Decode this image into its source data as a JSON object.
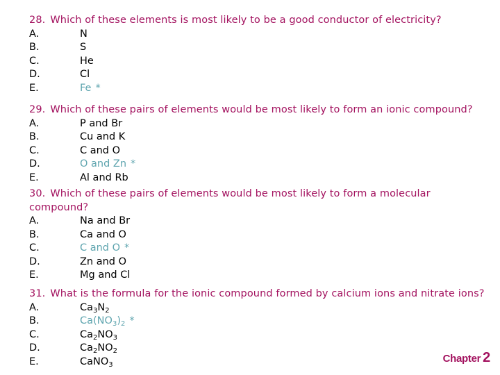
{
  "colors": {
    "question": "#A3125F",
    "answer_correct": "#5FA5AF",
    "option_text": "#000000"
  },
  "questions": [
    {
      "number": "28.",
      "text": "Which of these elements is most likely to be a good conductor of electricity?",
      "options": [
        {
          "letter": "A.",
          "value": "N",
          "correct": false
        },
        {
          "letter": "B.",
          "value": "S",
          "correct": false
        },
        {
          "letter": "C.",
          "value": "He",
          "correct": false
        },
        {
          "letter": "D.",
          "value": "Cl",
          "correct": false
        },
        {
          "letter": "E.",
          "value": "Fe",
          "correct": true,
          "marker": "*"
        }
      ]
    },
    {
      "number": "29.",
      "text": "Which of these pairs of elements would be most likely to form an ionic compound?",
      "options": [
        {
          "letter": "A.",
          "value": "P and Br",
          "correct": false
        },
        {
          "letter": "B.",
          "value": "Cu and K",
          "correct": false
        },
        {
          "letter": "C.",
          "value": "C and O",
          "correct": false
        },
        {
          "letter": "D.",
          "value": "O and Zn",
          "correct": true,
          "marker": "*"
        },
        {
          "letter": "E.",
          "value": "Al and Rb",
          "correct": false
        }
      ]
    },
    {
      "number": "30.",
      "text": "Which of these pairs of elements would be most likely to form a molecular compound?",
      "options": [
        {
          "letter": "A.",
          "value": "Na and Br",
          "correct": false
        },
        {
          "letter": "B.",
          "value": "Ca and O",
          "correct": false
        },
        {
          "letter": "C.",
          "value": "C and O",
          "correct": true,
          "marker": "*"
        },
        {
          "letter": "D.",
          "value": "Zn and O",
          "correct": false
        },
        {
          "letter": "E.",
          "value": "Mg and Cl",
          "correct": false
        }
      ]
    },
    {
      "number": "31.",
      "text": "What is the formula for the ionic compound formed by calcium ions and nitrate ions?",
      "options": [
        {
          "letter": "A.",
          "formula": [
            [
              "Ca",
              "3"
            ],
            [
              "N",
              "2"
            ]
          ],
          "value": "Ca3N2",
          "correct": false
        },
        {
          "letter": "B.",
          "formula": [
            [
              "Ca(NO",
              "3"
            ],
            [
              ")",
              "2"
            ]
          ],
          "value": "Ca(NO3)2",
          "correct": true,
          "marker": "*"
        },
        {
          "letter": "C.",
          "formula": [
            [
              "Ca",
              "2"
            ],
            [
              "NO",
              "3"
            ]
          ],
          "value": "Ca2NO3",
          "correct": false
        },
        {
          "letter": "D.",
          "formula": [
            [
              "Ca",
              "2"
            ],
            [
              "NO",
              "2"
            ]
          ],
          "value": "Ca2NO2",
          "correct": false
        },
        {
          "letter": "E.",
          "formula": [
            [
              "CaNO",
              "3"
            ]
          ],
          "value": "CaNO3",
          "correct": false
        }
      ]
    }
  ],
  "footer": {
    "label": "Chapter",
    "number": "2"
  }
}
